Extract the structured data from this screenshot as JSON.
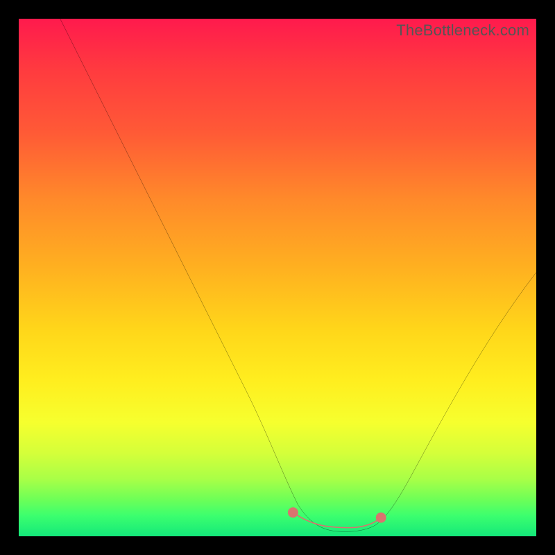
{
  "watermark": {
    "text": "TheBottleneck.com"
  },
  "colors": {
    "frame": "#000000",
    "curve": "#000000",
    "marker": "#d9736f",
    "gradient_stops": [
      "#ff1a4d",
      "#ff3b3f",
      "#ff5a36",
      "#ff8a2a",
      "#ffb020",
      "#ffd61a",
      "#ffee1f",
      "#f6ff2e",
      "#d4ff3a",
      "#a8ff47",
      "#6cff58",
      "#3cff6e",
      "#14e87a"
    ]
  },
  "chart_data": {
    "type": "line",
    "title": "",
    "xlabel": "",
    "ylabel": "",
    "xlim": [
      0,
      100
    ],
    "ylim": [
      0,
      100
    ],
    "grid": false,
    "legend": false,
    "series": [
      {
        "name": "bottleneck-curve",
        "x": [
          8,
          12,
          16,
          20,
          24,
          28,
          32,
          36,
          40,
          44,
          48,
          52,
          54,
          56,
          58,
          60,
          62,
          64,
          66,
          68,
          70,
          74,
          78,
          82,
          86,
          90,
          94,
          98,
          100
        ],
        "y": [
          100,
          92,
          84,
          76,
          68,
          60,
          52,
          44,
          36,
          28,
          20,
          12,
          9,
          6,
          4,
          2.5,
          1.5,
          1,
          1,
          1.2,
          2,
          6,
          12,
          20,
          28,
          36,
          42,
          48,
          51
        ]
      }
    ],
    "markers": {
      "name": "bottom-highlight",
      "x": [
        53,
        55,
        57,
        59,
        61,
        63,
        65,
        67,
        70
      ],
      "y": [
        4.2,
        3.5,
        3.1,
        2.8,
        2.6,
        2.5,
        2.6,
        2.8,
        4.0
      ]
    }
  }
}
